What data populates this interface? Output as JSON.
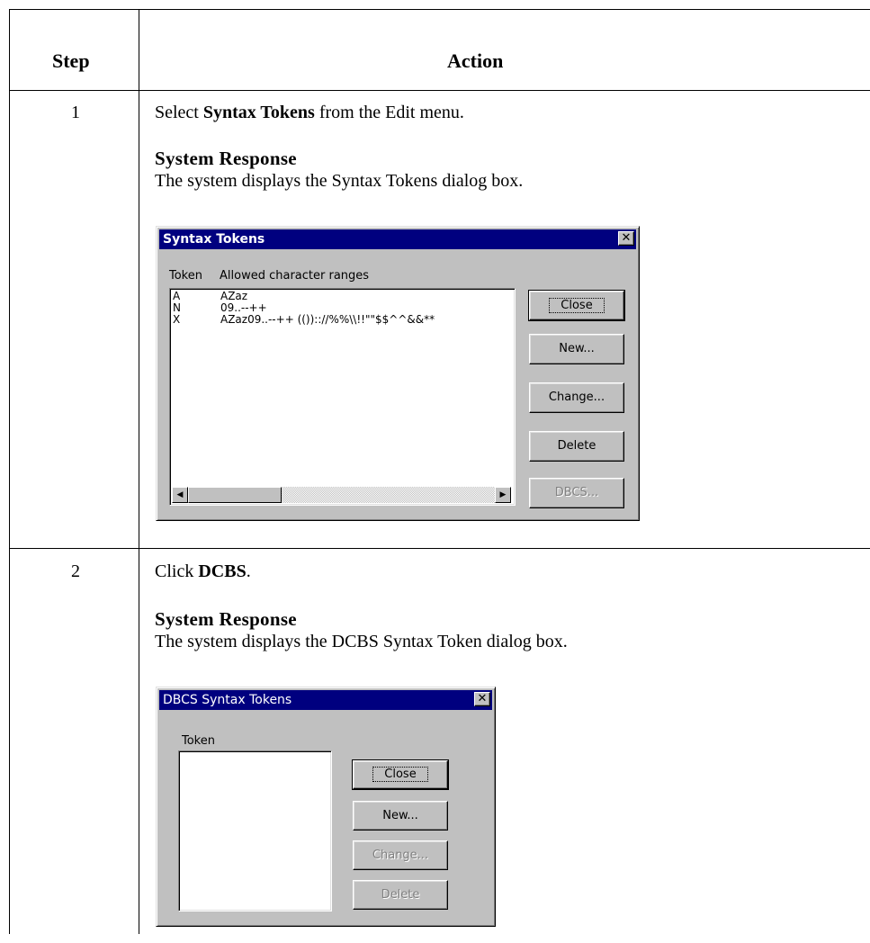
{
  "table": {
    "headers": {
      "step": "Step",
      "action": "Action"
    },
    "rows": [
      {
        "step": "1",
        "instruction": {
          "prefix": "Select ",
          "bold": "Syntax Tokens",
          "suffix": " from the Edit menu."
        },
        "response_title": "System Response",
        "response_text": "The system displays the Syntax Tokens dialog box."
      },
      {
        "step": "2",
        "instruction": {
          "prefix": "Click ",
          "bold": "DCBS",
          "suffix": "."
        },
        "response_title": "System Response",
        "response_text": "The system displays the DCBS Syntax Token dialog box."
      }
    ]
  },
  "dialog1": {
    "title": "Syntax Tokens",
    "col_token": "Token",
    "col_ranges": "Allowed character ranges",
    "tokens": [
      {
        "token": "A",
        "ranges": "AZaz"
      },
      {
        "token": "N",
        "ranges": "09..--++"
      },
      {
        "token": "X",
        "ranges": "AZaz09..--++  (()):://%%\\\\!!\"\"$$^^&&**"
      }
    ],
    "buttons": {
      "close": "Close",
      "new": "New...",
      "change": "Change...",
      "delete": "Delete",
      "dbcs": "DBCS..."
    }
  },
  "dialog2": {
    "title": "DBCS Syntax Tokens",
    "col_token": "Token",
    "buttons": {
      "close": "Close",
      "new": "New...",
      "change": "Change...",
      "delete": "Delete"
    }
  }
}
